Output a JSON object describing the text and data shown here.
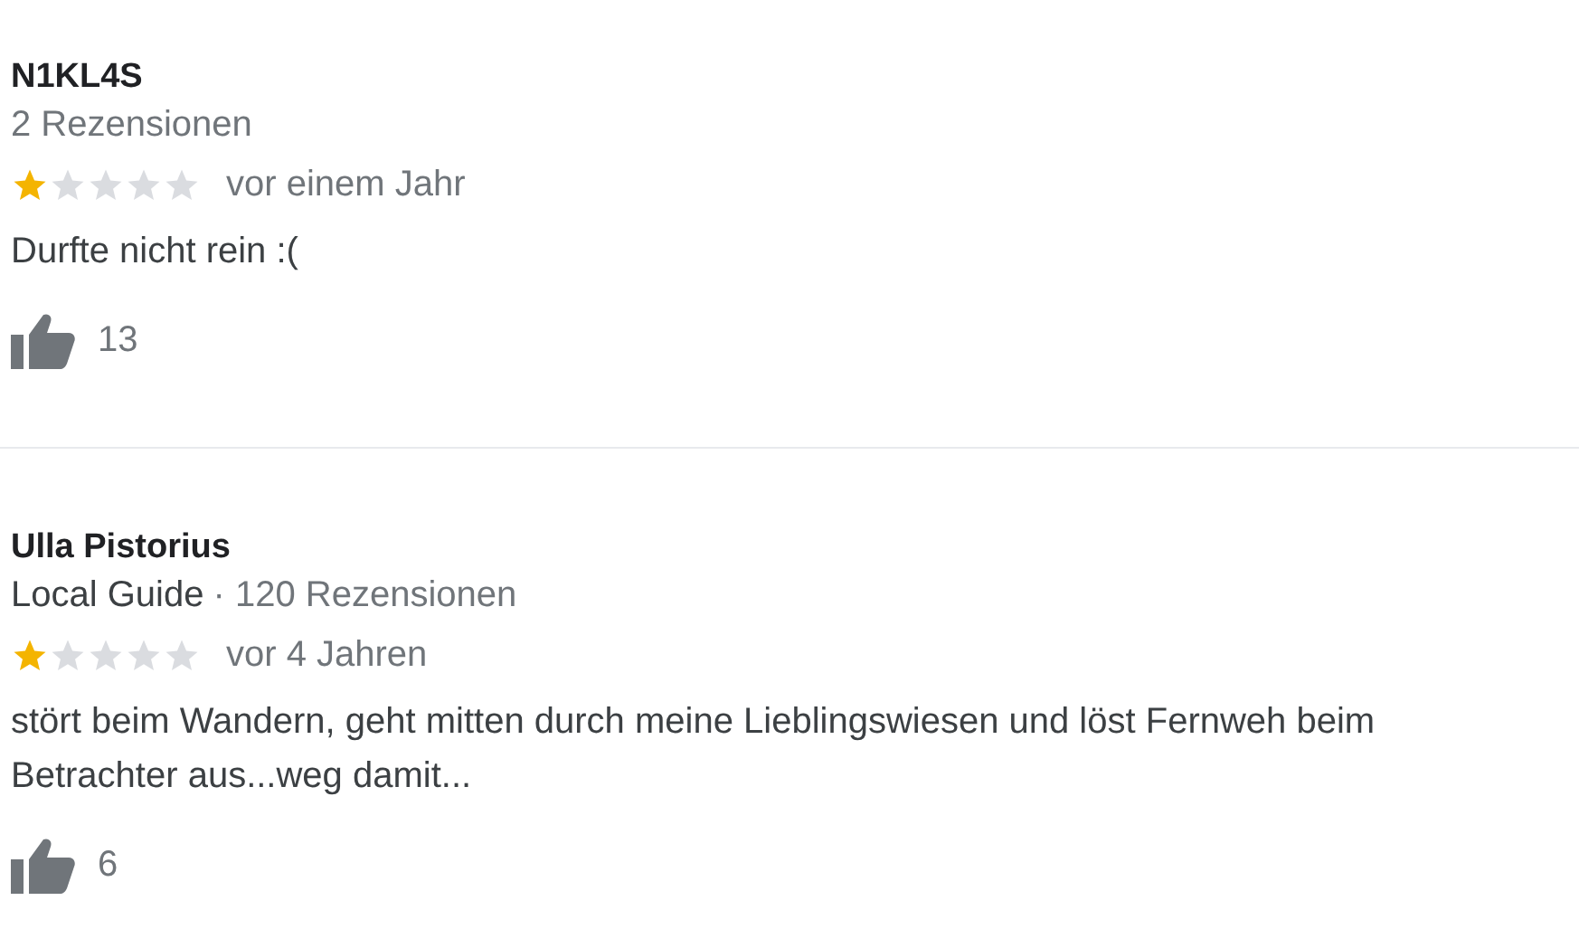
{
  "reviews": [
    {
      "author": "N1KL4S",
      "reviews_count": "2 Rezensionen",
      "stars": 1,
      "time": "vor einem Jahr",
      "text": "Durfte nicht rein :(",
      "likes": "13"
    },
    {
      "author": "Ulla Pistorius",
      "badge": "Local Guide",
      "reviews_count": "· 120 Rezensionen",
      "stars": 1,
      "time": "vor 4 Jahren",
      "text": "stört beim Wandern, geht mitten durch meine Lieblingswiesen und löst Fernweh beim Betrachter aus...weg damit...",
      "likes": "6"
    }
  ]
}
